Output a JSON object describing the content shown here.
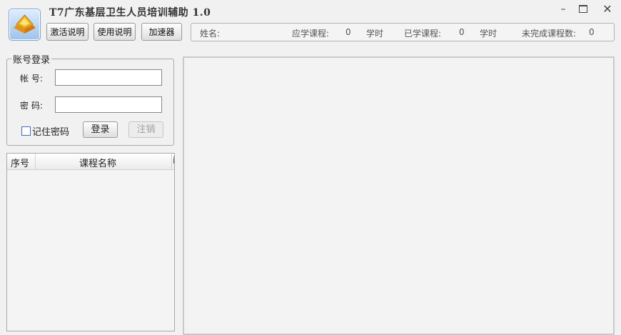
{
  "app": {
    "title": "T7广东基层卫生人员培训辅助 1.0",
    "window_controls": {
      "minimize": "–",
      "close": "✕"
    }
  },
  "toolbar": {
    "activate_help_label": "激活说明",
    "usage_help_label": "使用说明",
    "accelerator_label": "加速器"
  },
  "info_bar": {
    "name_label": "姓名:",
    "name_value": "",
    "required_label": "应学课程:",
    "required_value": "0",
    "required_unit": "学时",
    "learned_label": "已学课程:",
    "learned_value": "0",
    "learned_unit": "学时",
    "unfinished_label": "未完成课程数:",
    "unfinished_value": "0"
  },
  "login": {
    "group_title": "账号登录",
    "account_label": "帐  号:",
    "account_value": "",
    "password_label": "密  码:",
    "password_value": "",
    "remember_label": "记住密码",
    "remember_checked": false,
    "login_label": "登录",
    "logout_label": "注销"
  },
  "course_list": {
    "columns": [
      "序号",
      "课程名称",
      "i"
    ],
    "rows": []
  },
  "colors": {
    "window_bg": "#f1f1f1",
    "checkbox_border": "#3d6fb5",
    "logo_accent": "#e8a317"
  },
  "icons": {
    "app_logo": "diamond-logo-icon"
  }
}
